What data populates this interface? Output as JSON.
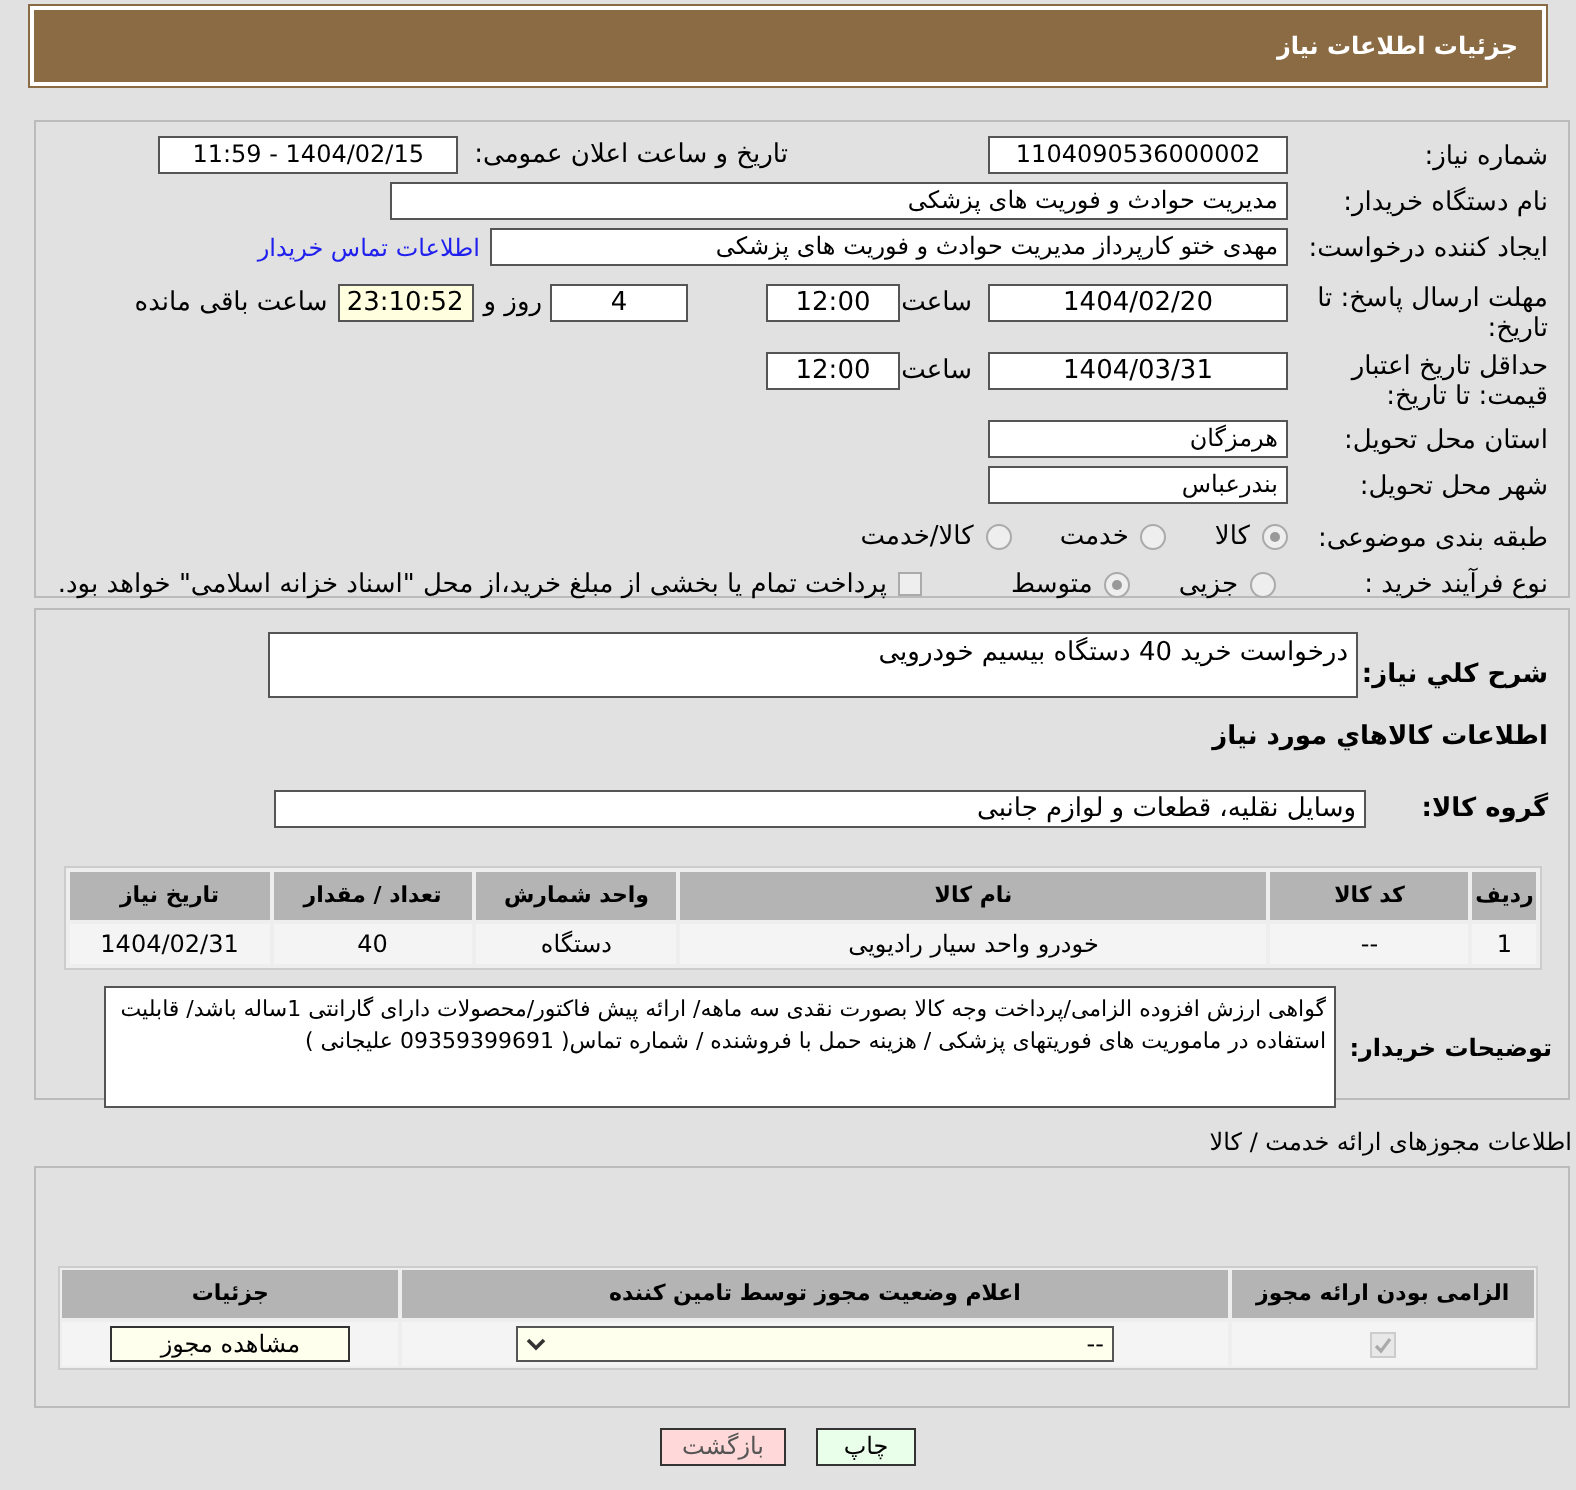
{
  "header": {
    "title": "جزئیات اطلاعات نیاز"
  },
  "need_number": {
    "label": "شماره نیاز:",
    "value": "1104090536000002"
  },
  "announce": {
    "label": "تاریخ و ساعت اعلان عمومی:",
    "value": "1404/02/15 - 11:59"
  },
  "buyer_org": {
    "label": "نام دستگاه خریدار:",
    "value": "مدیریت حوادث و فوریت های پزشکی"
  },
  "requester": {
    "label": "ایجاد کننده درخواست:",
    "value": "مهدی ختو کارپرداز مدیریت حوادث و فوریت های پزشکی",
    "link": "اطلاعات تماس خریدار"
  },
  "reply_deadline": {
    "label": "مهلت ارسال پاسخ: تا تاریخ:",
    "date": "1404/02/20",
    "time_label": "ساعت",
    "time": "12:00",
    "days": "4",
    "days_label": "روز و",
    "remaining": "23:10:52",
    "remaining_label": "ساعت باقی مانده"
  },
  "price_validity": {
    "label": "حداقل تاریخ اعتبار قیمت: تا تاریخ:",
    "date": "1404/03/31",
    "time_label": "ساعت",
    "time": "12:00"
  },
  "province": {
    "label": "استان محل تحویل:",
    "value": "هرمزگان"
  },
  "city": {
    "label": "شهر محل تحویل:",
    "value": "بندرعباس"
  },
  "category": {
    "label": "طبقه بندی موضوعی:",
    "options": [
      {
        "label": "کالا",
        "selected": true
      },
      {
        "label": "خدمت",
        "selected": false
      },
      {
        "label": "کالا/خدمت",
        "selected": false
      }
    ]
  },
  "purchase_process": {
    "label": "نوع فرآیند خرید :",
    "options": [
      {
        "label": "جزیی",
        "selected": false
      },
      {
        "label": "متوسط",
        "selected": true
      }
    ],
    "payment": {
      "label": "پرداخت تمام یا بخشی از مبلغ خرید،از محل \"اسناد خزانه اسلامی\" خواهد بود.",
      "checked": false
    }
  },
  "description": {
    "label": "شرح کلي نياز:",
    "value": "درخواست خرید 40 دستگاه بیسیم خودرویی"
  },
  "goods_heading": "اطلاعات كالاهاي مورد نياز",
  "goods_group": {
    "label": "گروه كالا:",
    "value": "وسایل نقلیه، قطعات و لوازم جانبی"
  },
  "goods_table": {
    "columns": [
      "ردیف",
      "کد کالا",
      "نام کالا",
      "واحد شمارش",
      "تعداد / مقدار",
      "تاریخ نیاز"
    ],
    "rows": [
      [
        "1",
        "--",
        "خودرو واحد سیار رادیویی",
        "دستگاه",
        "40",
        "1404/02/31"
      ]
    ]
  },
  "buyer_notes": {
    "label": "توضیحات خریدار:",
    "value": "گواهی ارزش افزوده الزامی/پرداخت وجه کالا بصورت نقدی سه ماهه/ ارائه پیش فاکتور/محصولات دارای گارانتی 1ساله باشد/ قابلیت استفاده در ماموریت های فوریتهای پزشکی / هزینه حمل با فروشنده / شماره تماس( 09359399691 علیجانی )"
  },
  "permits_heading": "اطلاعات مجوزهای ارائه خدمت / کالا",
  "permits_table": {
    "columns": [
      "الزامی بودن ارائه مجوز",
      "اعلام وضعیت مجوز توسط تامین کننده",
      "جزئیات"
    ],
    "rows": [
      {
        "required": true,
        "status": "--",
        "details": "مشاهده مجوز"
      }
    ]
  },
  "buttons": [
    {
      "label": "چاپ",
      "kind": "print"
    },
    {
      "label": "بازگشت",
      "kind": "back"
    }
  ]
}
